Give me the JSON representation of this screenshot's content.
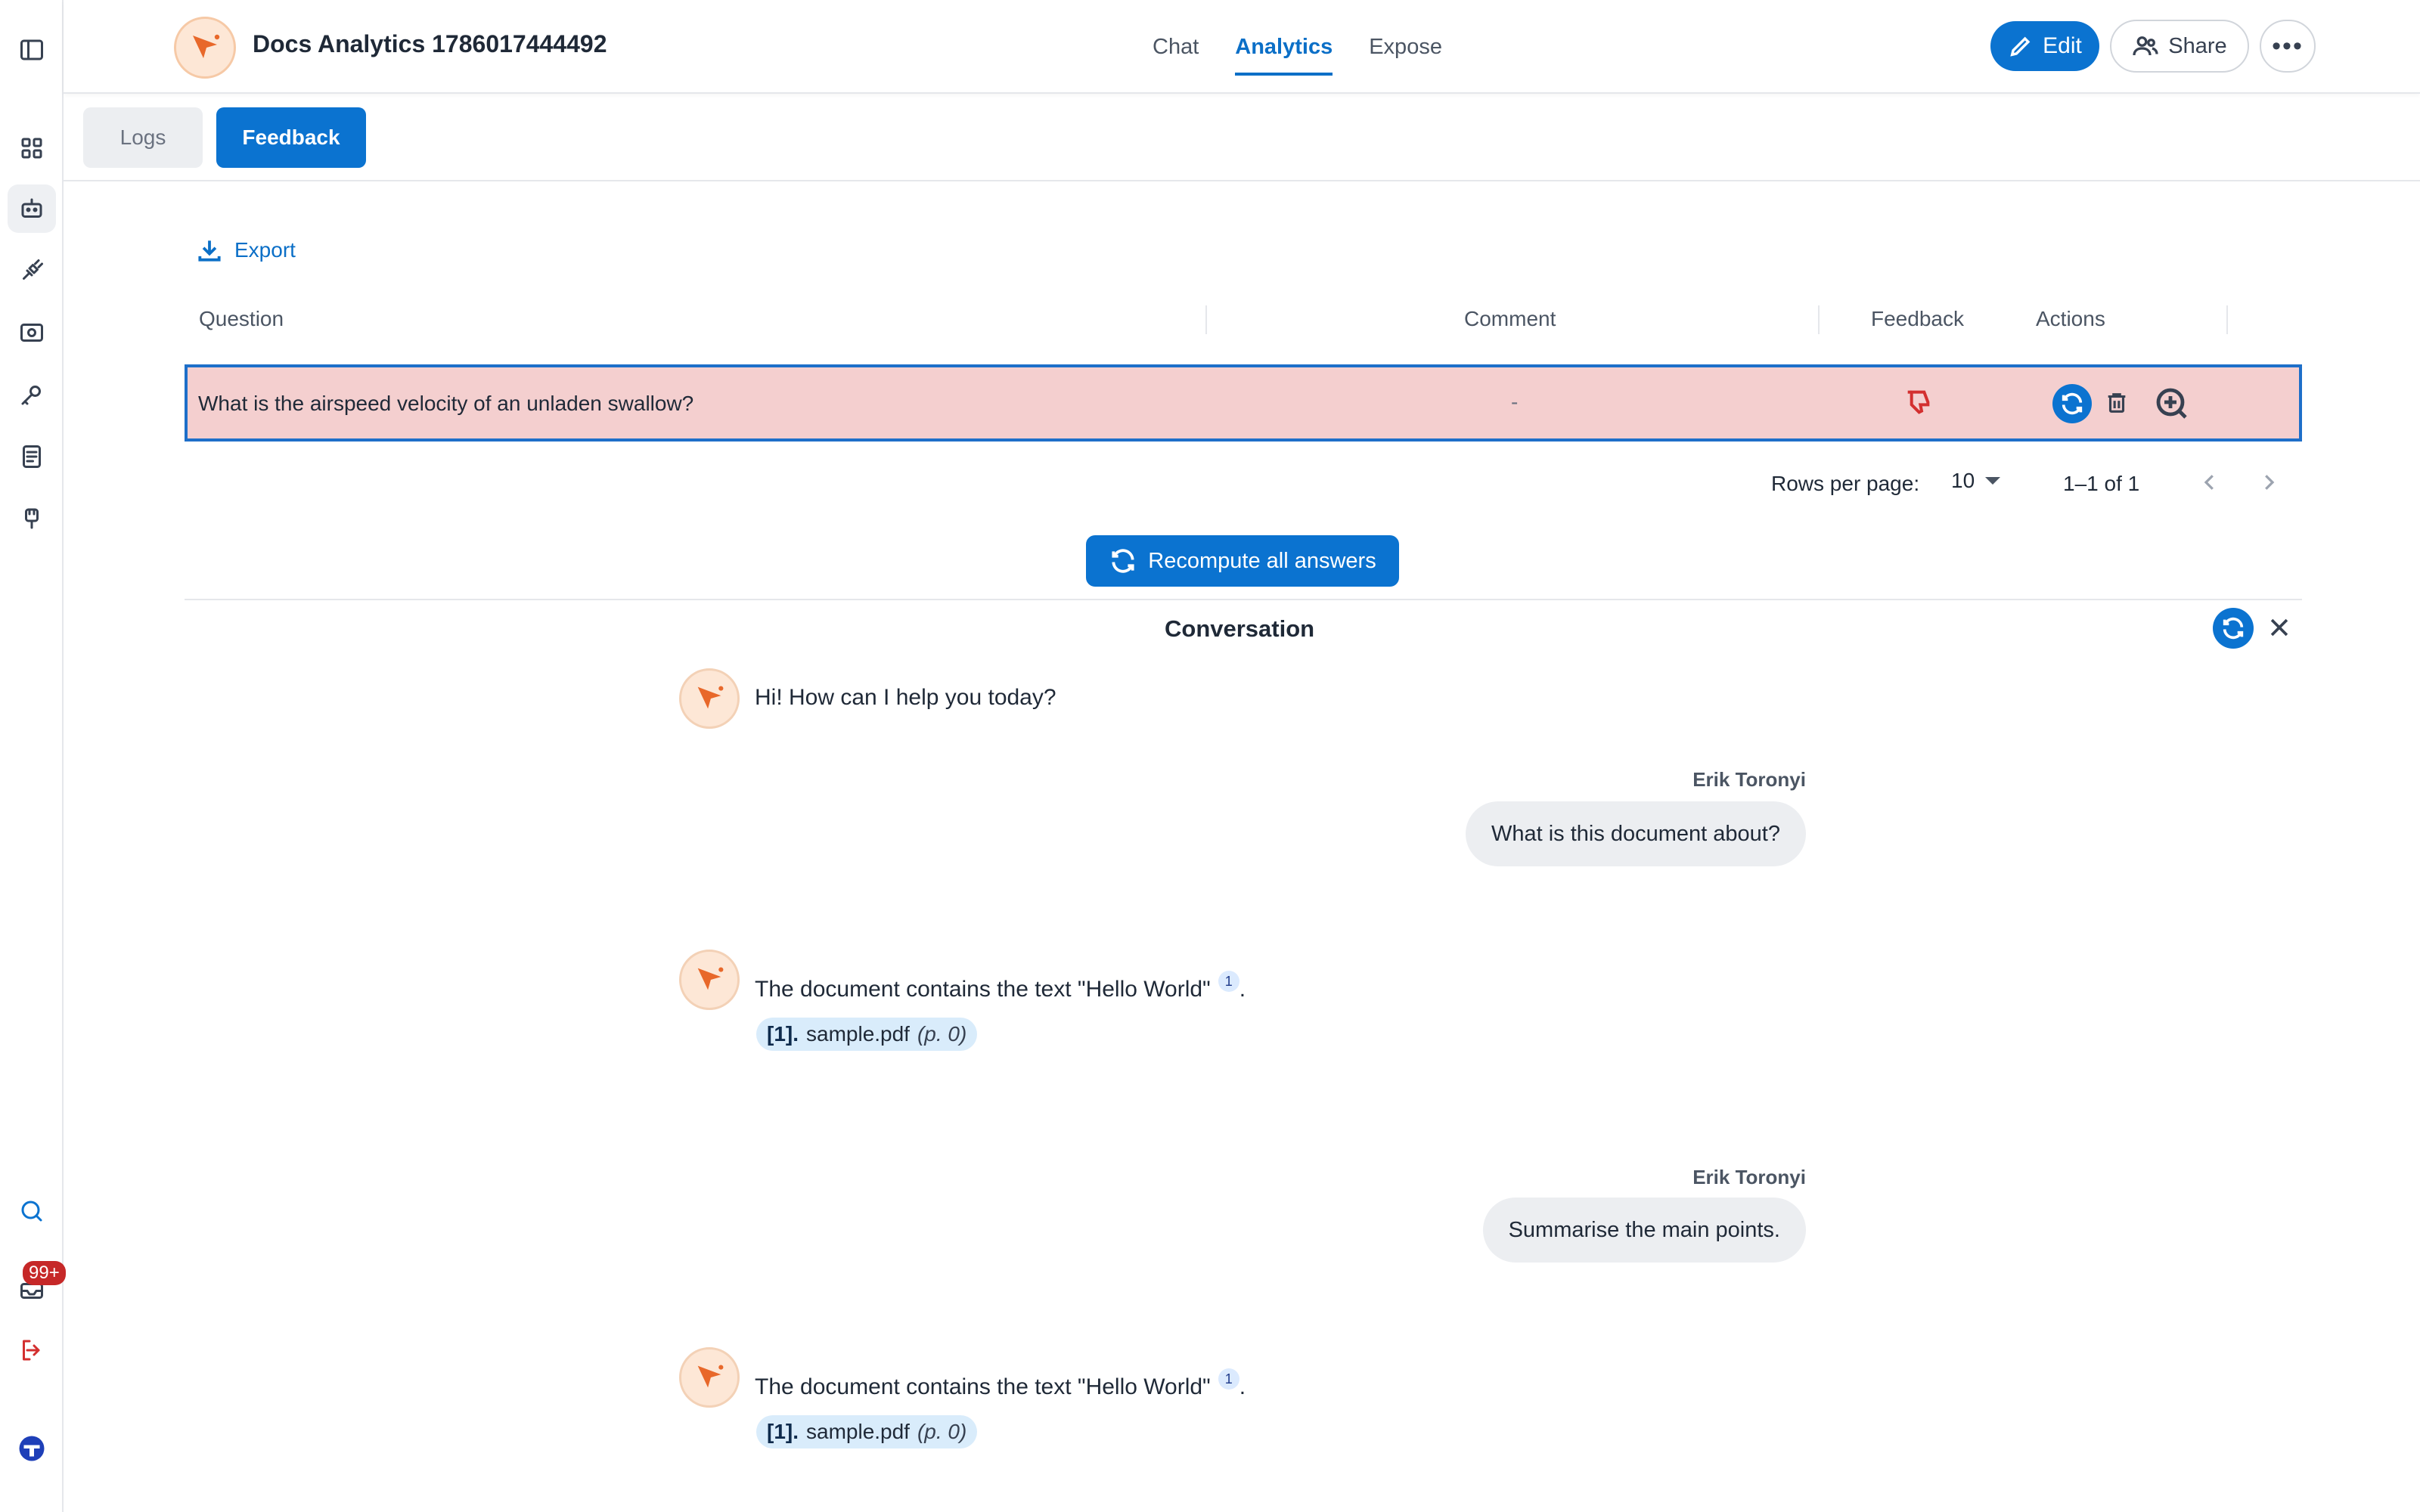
{
  "app": {
    "title": "Docs Analytics 1786017444492"
  },
  "nav_tabs": [
    {
      "label": "Chat"
    },
    {
      "label": "Analytics"
    },
    {
      "label": "Expose"
    }
  ],
  "header_actions": {
    "edit_label": "Edit",
    "share_label": "Share"
  },
  "sub_tabs": {
    "logs": "Logs",
    "feedback": "Feedback"
  },
  "export_label": "Export",
  "table": {
    "columns": [
      "Question",
      "Comment",
      "Feedback",
      "Actions"
    ],
    "rows": [
      {
        "question": "What is the airspeed velocity of an unladen swallow?",
        "comment": "-",
        "feedback": "thumbs-down"
      }
    ]
  },
  "pagination": {
    "rows_per_page_label": "Rows per page:",
    "rows_per_page": "10",
    "range": "1–1 of 1"
  },
  "recompute_all_label": "Recompute all answers",
  "conversation": {
    "title": "Conversation",
    "messages": [
      {
        "role": "bot",
        "text": "Hi! How can I help you today?"
      },
      {
        "role": "user",
        "name": "Erik Toronyi",
        "text": "What is this document about?"
      },
      {
        "role": "bot",
        "text": "The document contains the text \"Hello World\"",
        "ref": "1",
        "period": ".",
        "cite_num": "[1].",
        "cite_file": "sample.pdf",
        "cite_page": "(p. 0)"
      },
      {
        "role": "user",
        "name": "Erik Toronyi",
        "text": "Summarise the main points."
      },
      {
        "role": "bot",
        "text": "The document contains the text \"Hello World\"",
        "ref": "1",
        "period": ".",
        "cite_num": "[1].",
        "cite_file": "sample.pdf",
        "cite_page": "(p. 0)"
      }
    ]
  },
  "notifications_badge": "99+",
  "colors": {
    "accent": "#0b73d0",
    "selected_row": "#f4cfcf",
    "negative": "#d32f2f",
    "bot_orange": "#e8682a"
  },
  "icons": [
    "sidebar-toggle-icon",
    "dashboard-icon",
    "bot-icon",
    "plug-icon",
    "settings-icon",
    "key-icon",
    "document-icon",
    "connector-icon",
    "search-people-icon",
    "inbox-icon",
    "logout-icon",
    "user-avatar-icon"
  ]
}
